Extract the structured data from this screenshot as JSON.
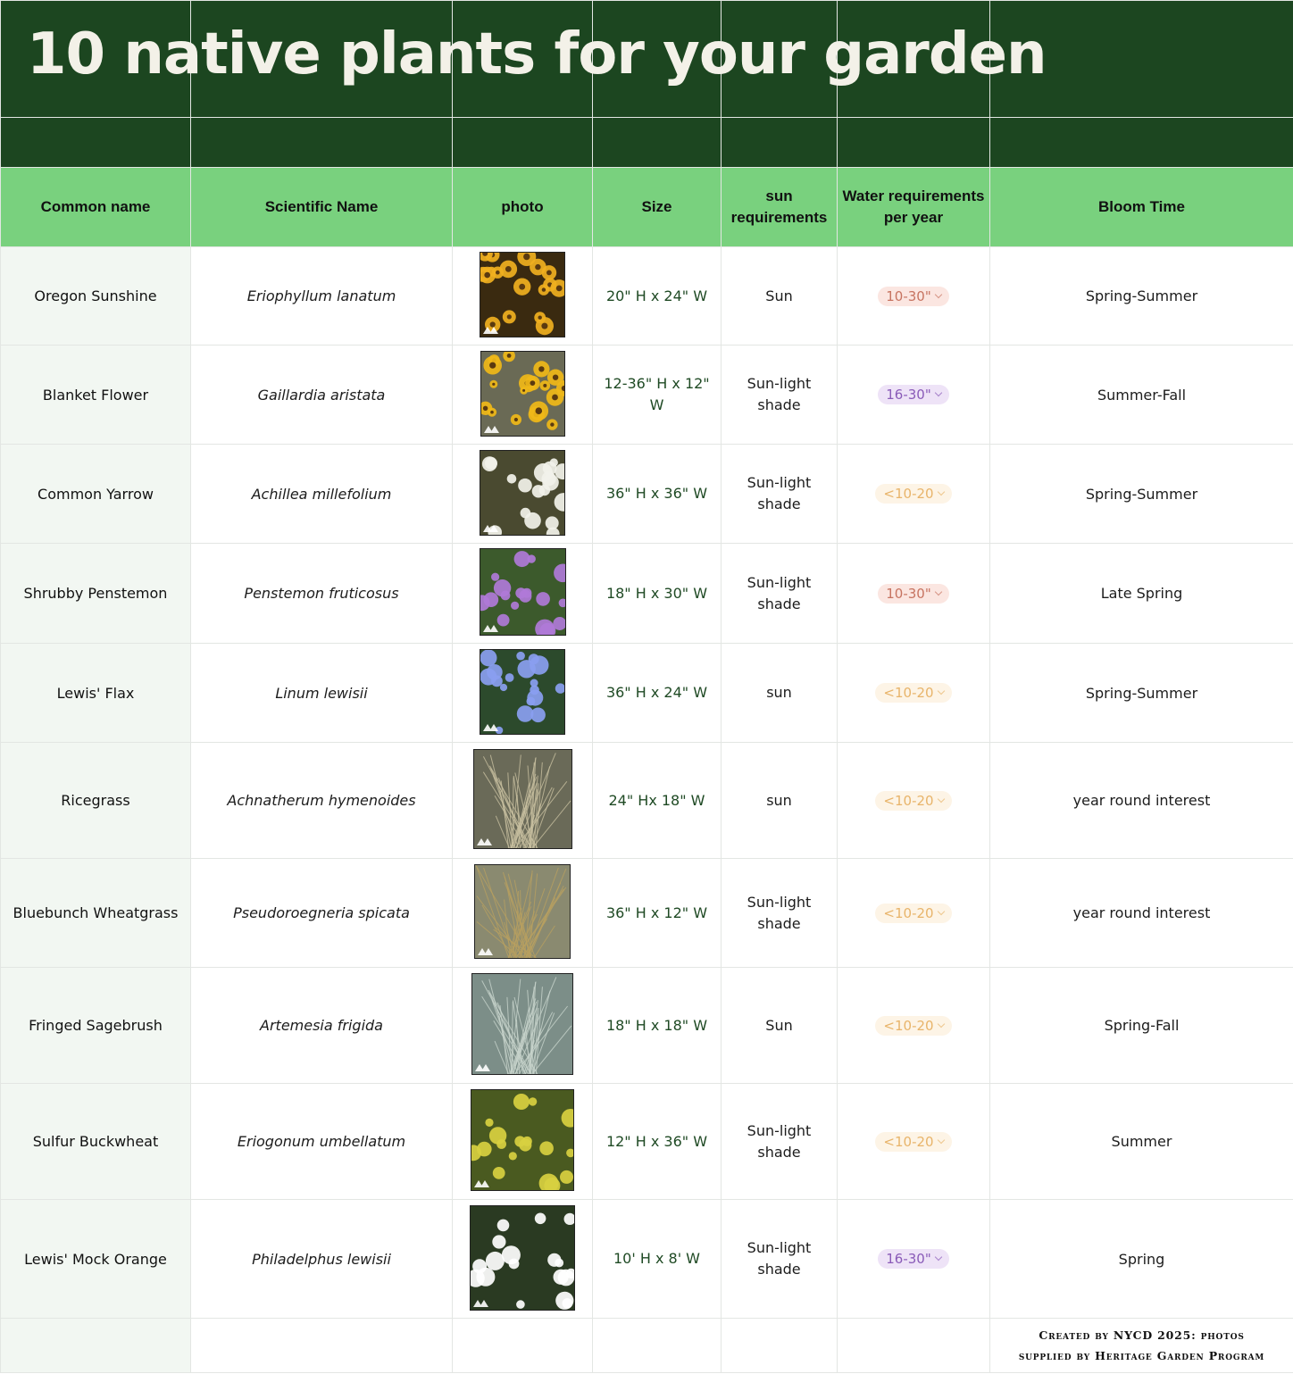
{
  "title": "10 native plants for your garden",
  "colors": {
    "dark_green": "#1c4620",
    "header_green": "#79d17e",
    "name_column_bg": "#f2f7f2"
  },
  "columns": [
    "Common name",
    "Scientific Name",
    "photo",
    "Size",
    "sun requirements",
    "Water requirements per year",
    "Bloom Time"
  ],
  "rows": [
    {
      "common": "Oregon Sunshine",
      "scientific": "Eriophyllum lanatum",
      "photo": "yellow-daisy-flowers-photo",
      "size": "20\" H x 24\" W",
      "sun": "Sun",
      "water": "10-30\"",
      "water_style": "a",
      "bloom": "Spring-Summer"
    },
    {
      "common": "Blanket Flower",
      "scientific": "Gaillardia aristata",
      "photo": "blanket-flower-photo",
      "size": "12-36\" H x 12\" W",
      "sun": "Sun-light shade",
      "water": "16-30\"",
      "water_style": "b",
      "bloom": "Summer-Fall"
    },
    {
      "common": "Common Yarrow",
      "scientific": "Achillea millefolium",
      "photo": "white-yarrow-photo",
      "size": "36\" H x 36\" W",
      "sun": "Sun-light shade",
      "water": "<10-20",
      "water_style": "c",
      "bloom": "Spring-Summer"
    },
    {
      "common": "Shrubby Penstemon",
      "scientific": "Penstemon fruticosus",
      "photo": "purple-penstemon-photo",
      "size": "18\" H x 30\" W",
      "sun": "Sun-light shade",
      "water": "10-30\"",
      "water_style": "a",
      "bloom": "Late Spring"
    },
    {
      "common": "Lewis' Flax",
      "scientific": "Linum lewisii",
      "photo": "blue-flax-photo",
      "size": "36\" H x 24\" W",
      "sun": "sun",
      "water": "<10-20",
      "water_style": "c",
      "bloom": "Spring-Summer"
    },
    {
      "common": "Ricegrass",
      "scientific": "Achnatherum hymenoides",
      "photo": "ricegrass-photo",
      "size": "24\" Hx 18\" W",
      "sun": "sun",
      "water": "<10-20",
      "water_style": "c",
      "bloom": "year round interest"
    },
    {
      "common": "Bluebunch Wheatgrass",
      "scientific": "Pseudoroegneria spicata",
      "photo": "wheatgrass-photo",
      "size": "36\" H x 12\" W",
      "sun": "Sun-light shade",
      "water": "<10-20",
      "water_style": "c",
      "bloom": "year round interest"
    },
    {
      "common": "Fringed Sagebrush",
      "scientific": "Artemesia frigida",
      "photo": "sagebrush-photo",
      "size": "18\" H x 18\" W",
      "sun": "Sun",
      "water": "<10-20",
      "water_style": "c",
      "bloom": "Spring-Fall"
    },
    {
      "common": "Sulfur Buckwheat",
      "scientific": "Eriogonum umbellatum",
      "photo": "sulfur-buckwheat-photo",
      "size": "12\" H x 36\" W",
      "sun": "Sun-light shade",
      "water": "<10-20",
      "water_style": "c",
      "bloom": "Summer"
    },
    {
      "common": "Lewis' Mock Orange",
      "scientific": "Philadelphus lewisii",
      "photo": "mock-orange-photo",
      "size": "10' H x 8' W",
      "sun": "Sun-light shade",
      "water": "16-30\"",
      "water_style": "b",
      "bloom": "Spring"
    }
  ],
  "footer": {
    "credit_line1": "Created by NYCD 2025: photos",
    "credit_line2": "supplied by Heritage Garden Program"
  }
}
